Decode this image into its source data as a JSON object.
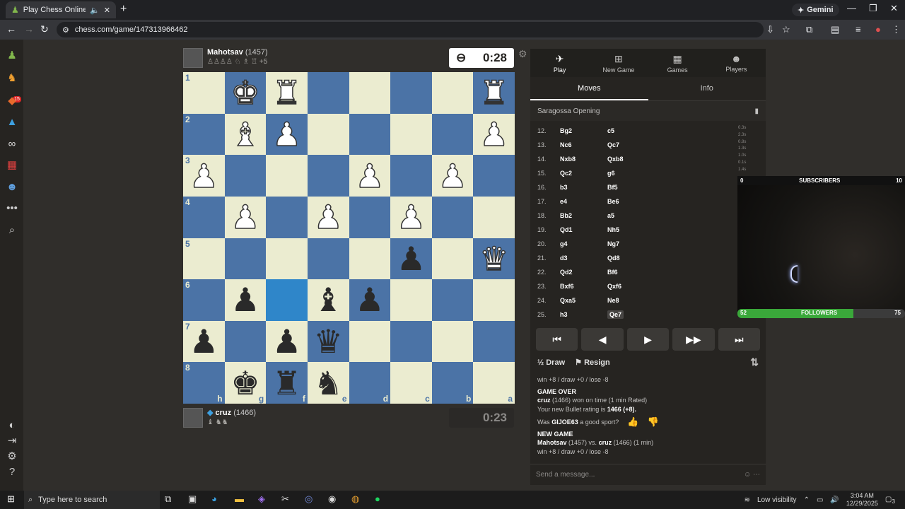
{
  "browser": {
    "tab_title": "Play Chess Online for FREE",
    "url": "chess.com/game/147313966462",
    "gemini_label": "Gemini"
  },
  "sidebar": {
    "badge": "15",
    "icons": [
      "chess-logo-icon",
      "puzzle-icon",
      "learn-icon",
      "watch-icon",
      "binoculars-icon",
      "news-icon",
      "social-icon",
      "more-icon",
      "search-icon"
    ]
  },
  "top_player": {
    "name": "Mahotsav",
    "rating": "(1457)",
    "captures": "♙♙♙♙ ♘ ♗ ♖  +5",
    "clock": "0:28"
  },
  "bottom_player": {
    "name": "cruz",
    "rating": "(1466)",
    "captures": "♝ ♞♞",
    "clock": "0:23"
  },
  "board": {
    "ranks": [
      "1",
      "2",
      "3",
      "4",
      "5",
      "6",
      "7",
      "8"
    ],
    "files": [
      "h",
      "g",
      "f",
      "e",
      "d",
      "c",
      "b",
      "a"
    ],
    "rows": [
      [
        "",
        "wK",
        "wR",
        "",
        "",
        "",
        "",
        "wR"
      ],
      [
        "",
        "wB",
        "wP",
        "",
        "",
        "",
        "",
        "wP"
      ],
      [
        "wP",
        "",
        "",
        "",
        "wP",
        "",
        "wP",
        ""
      ],
      [
        "",
        "wP",
        "",
        "wP",
        "",
        "wP",
        "",
        ""
      ],
      [
        "",
        "",
        "",
        "",
        "",
        "bP",
        "",
        "wQ"
      ],
      [
        "",
        "bP",
        "",
        "bB",
        "bP",
        "",
        "",
        ""
      ],
      [
        "bP",
        "",
        "bP",
        "bQ",
        "",
        "",
        "",
        ""
      ],
      [
        "",
        "bK",
        "bR",
        "bN",
        "",
        "",
        "",
        ""
      ]
    ]
  },
  "panel": {
    "tabs": [
      {
        "label": "Play",
        "icon": "play-icon"
      },
      {
        "label": "New Game",
        "icon": "plus-icon"
      },
      {
        "label": "Games",
        "icon": "board-icon"
      },
      {
        "label": "Players",
        "icon": "players-icon"
      }
    ],
    "subtabs": [
      "Moves",
      "Info"
    ],
    "opening": "Saragossa Opening",
    "moves": [
      {
        "n": "12.",
        "w": "Bg2",
        "b": "c5"
      },
      {
        "n": "13.",
        "w": "Nc6",
        "b": "Qc7"
      },
      {
        "n": "14.",
        "w": "Nxb8",
        "b": "Qxb8"
      },
      {
        "n": "15.",
        "w": "Qc2",
        "b": "g6"
      },
      {
        "n": "16.",
        "w": "b3",
        "b": "Bf5"
      },
      {
        "n": "17.",
        "w": "e4",
        "b": "Be6"
      },
      {
        "n": "18.",
        "w": "Bb2",
        "b": "a5"
      },
      {
        "n": "19.",
        "w": "Qd1",
        "b": "Nh5"
      },
      {
        "n": "20.",
        "w": "g4",
        "b": "Ng7"
      },
      {
        "n": "21.",
        "w": "d3",
        "b": "Qd8"
      },
      {
        "n": "22.",
        "w": "Qd2",
        "b": "Bf6"
      },
      {
        "n": "23.",
        "w": "Bxf6",
        "b": "Qxf6"
      },
      {
        "n": "24.",
        "w": "Qxa5",
        "b": "Ne8"
      },
      {
        "n": "25.",
        "w": "h3",
        "b": "Qe7"
      }
    ],
    "times": [
      "0.3s",
      "2.3s",
      "0.8s",
      "1.3s",
      "1.0s",
      "0.1s",
      "1.4s"
    ],
    "draw_label": "Draw",
    "resign_label": "Resign",
    "chat": {
      "line0": "win +8 / draw +0 / lose -8",
      "gameover": "GAME OVER",
      "result_name": "cruz",
      "result_rest": "(1466) won on time (1 min Rated)",
      "newrating_pre": "Your new Bullet rating is",
      "newrating_val": "1466 (+8).",
      "sport_pre": "Was",
      "sport_name": "GIJOE63",
      "sport_post": "a good sport?",
      "newgame": "NEW GAME",
      "ng_p1": "Mahotsav",
      "ng_mid": "(1457) vs.",
      "ng_p2": "cruz",
      "ng_rest": "(1466) (1 min)",
      "ng_line": "win +8 / draw +0 / lose -8",
      "placeholder": "Send a message..."
    }
  },
  "overlay": {
    "subscribers_left": "0",
    "subscribers_label": "SUBSCRIBERS",
    "subscribers_right": "10",
    "followers_left": "52",
    "followers_label": "FOLLOWERS",
    "followers_right": "75",
    "followers_progress": 0.69
  },
  "taskbar": {
    "search_placeholder": "Type here to search",
    "weather": "Low visibility",
    "time": "3:04 AM",
    "date": "12/29/2025",
    "notif": "3"
  }
}
